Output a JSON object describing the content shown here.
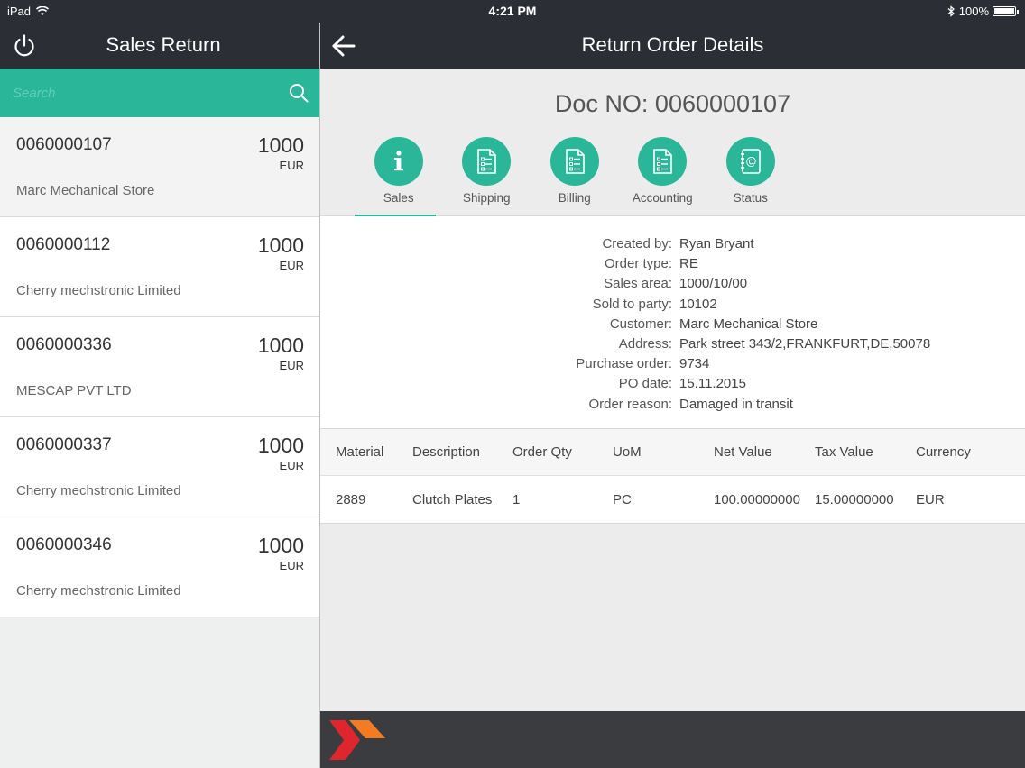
{
  "status_bar": {
    "device": "iPad",
    "time": "4:21 PM",
    "battery": "100%"
  },
  "left_panel": {
    "title": "Sales Return",
    "search_placeholder": "Search",
    "items": [
      {
        "doc_no": "0060000107",
        "amount": "1000",
        "currency": "EUR",
        "customer": "Marc Mechanical Store"
      },
      {
        "doc_no": "0060000112",
        "amount": "1000",
        "currency": "EUR",
        "customer": "Cherry mechstronic Limited"
      },
      {
        "doc_no": "0060000336",
        "amount": "1000",
        "currency": "EUR",
        "customer": "MESCAP PVT LTD"
      },
      {
        "doc_no": "0060000337",
        "amount": "1000",
        "currency": "EUR",
        "customer": "Cherry mechstronic Limited"
      },
      {
        "doc_no": "0060000346",
        "amount": "1000",
        "currency": "EUR",
        "customer": "Cherry mechstronic Limited"
      }
    ]
  },
  "right_panel": {
    "title": "Return Order Details",
    "doc_title": "Doc NO: 0060000107",
    "tabs": [
      {
        "label": "Sales",
        "icon": "info-icon"
      },
      {
        "label": "Shipping",
        "icon": "document-icon"
      },
      {
        "label": "Billing",
        "icon": "document-icon"
      },
      {
        "label": "Accounting",
        "icon": "document-icon"
      },
      {
        "label": "Status",
        "icon": "address-book-icon"
      }
    ],
    "details": [
      {
        "key": "Created by:",
        "value": "Ryan Bryant"
      },
      {
        "key": "Order type:",
        "value": "RE"
      },
      {
        "key": "Sales area:",
        "value": "1000/10/00"
      },
      {
        "key": "Sold to party:",
        "value": "10102"
      },
      {
        "key": "Customer:",
        "value": "Marc Mechanical Store"
      },
      {
        "key": "Address:",
        "value": "Park street 343/2,FRANKFURT,DE,50078"
      },
      {
        "key": "Purchase order:",
        "value": "9734"
      },
      {
        "key": "PO date:",
        "value": "15.11.2015"
      },
      {
        "key": "Order reason:",
        "value": "Damaged in transit"
      }
    ],
    "table": {
      "headers": [
        "Material",
        "Description",
        "Order Qty",
        "UoM",
        "Net Value",
        "Tax Value",
        "Currency"
      ],
      "rows": [
        [
          "2889",
          "Clutch Plates",
          "1",
          "PC",
          "100.00000000",
          "15.00000000",
          "EUR"
        ]
      ]
    }
  },
  "colors": {
    "accent": "#2ab699",
    "header": "#2c2e35",
    "logo_red": "#e0262d",
    "logo_orange": "#f47b20"
  }
}
